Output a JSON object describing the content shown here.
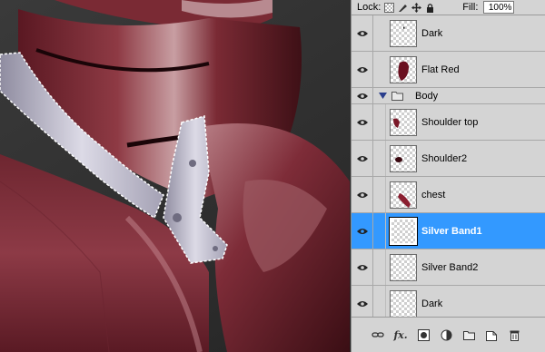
{
  "toolbar": {
    "lock_label": "Lock:",
    "fill_label": "Fill:",
    "fill_value": "100%"
  },
  "layers": [
    {
      "name": "Dark",
      "visible": true,
      "selected": false,
      "kind": "layer"
    },
    {
      "name": "Flat Red",
      "visible": true,
      "selected": false,
      "kind": "layer"
    },
    {
      "name": "Body",
      "visible": true,
      "selected": false,
      "kind": "group",
      "expanded": true
    },
    {
      "name": "Shoulder top",
      "visible": true,
      "selected": false,
      "kind": "layer"
    },
    {
      "name": "Shoulder2",
      "visible": true,
      "selected": false,
      "kind": "layer"
    },
    {
      "name": "chest",
      "visible": true,
      "selected": false,
      "kind": "layer"
    },
    {
      "name": "Silver Band1",
      "visible": true,
      "selected": true,
      "kind": "layer"
    },
    {
      "name": "Silver Band2",
      "visible": true,
      "selected": false,
      "kind": "layer"
    },
    {
      "name": "Dark",
      "visible": true,
      "selected": false,
      "kind": "layer"
    }
  ],
  "bottom_icons": [
    "link-layers-icon",
    "layer-style-fx-icon",
    "add-mask-icon",
    "adjustment-layer-icon",
    "new-group-icon",
    "new-layer-icon",
    "trash-icon"
  ],
  "bottom_labels": {
    "fx": "fx."
  },
  "colors": {
    "selected_row": "#3399ff",
    "panel_bg": "#d4d4d4"
  }
}
